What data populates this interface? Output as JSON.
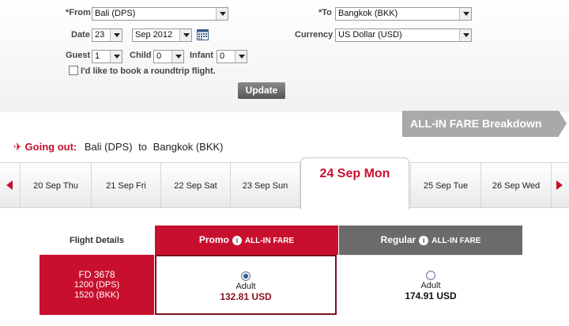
{
  "search": {
    "from_label": "*From",
    "from_value": "Bali (DPS)",
    "to_label": "*To",
    "to_value": "Bangkok (BKK)",
    "date_label": "Date",
    "date_day": "23",
    "date_month": "Sep 2012",
    "currency_label": "Currency",
    "currency_value": "US Dollar (USD)",
    "guest_label": "Guest",
    "guest_value": "1",
    "child_label": "Child",
    "child_value": "0",
    "infant_label": "Infant",
    "infant_value": "0",
    "roundtrip_label": "I'd like to book a roundtrip flight.",
    "roundtrip_checked": false,
    "update_label": "Update"
  },
  "fare_banner": "ALL-IN FARE Breakdown",
  "going_out": {
    "title": "Going out:",
    "origin": "Bali (DPS)",
    "connector": "to",
    "destination": "Bangkok (BKK)"
  },
  "dates": [
    {
      "label": "20 Sep Thu"
    },
    {
      "label": "21 Sep Fri"
    },
    {
      "label": "22 Sep Sat"
    },
    {
      "label": "23 Sep Sun"
    },
    {
      "label": "24 Sep Mon",
      "selected": true
    },
    {
      "label": "25 Sep Tue"
    },
    {
      "label": "26 Sep Wed"
    }
  ],
  "table": {
    "flight_details_label": "Flight Details",
    "promo_label": "Promo",
    "promo_sub": "ALL-IN FARE",
    "regular_label": "Regular",
    "regular_sub": "ALL-IN FARE",
    "flight": {
      "number": "FD  3678",
      "depart": "1200  (DPS)",
      "arrive": "1520  (BKK)"
    },
    "promo_pax": "Adult",
    "promo_price": "132.81 USD",
    "regular_pax": "Adult",
    "regular_price": "174.91 USD"
  },
  "colors": {
    "brand_red": "#c8102e",
    "regular_header": "#6b6b6b",
    "banner_gray": "#a9a9a9"
  }
}
